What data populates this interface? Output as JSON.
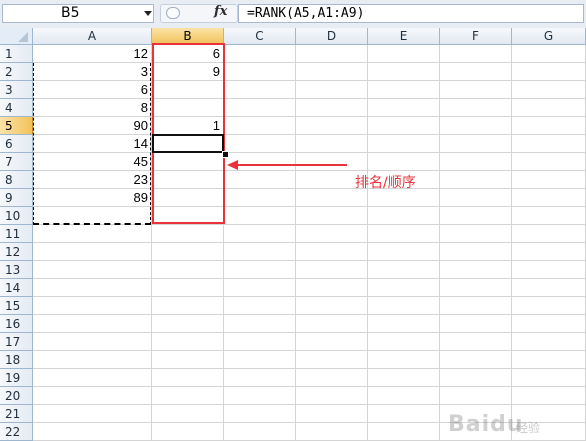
{
  "formula_bar": {
    "name_box": "B5",
    "fx_label": "fx",
    "formula": "=RANK(A5,A1:A9)"
  },
  "columns": [
    "A",
    "B",
    "C",
    "D",
    "E",
    "F",
    "G"
  ],
  "active_column": "B",
  "rows": [
    "1",
    "2",
    "3",
    "4",
    "5",
    "6",
    "7",
    "8",
    "9",
    "10",
    "11",
    "12",
    "13",
    "14",
    "15",
    "16",
    "17",
    "18",
    "19",
    "20",
    "21",
    "22"
  ],
  "active_row": "5",
  "column_a": [
    "12",
    "3",
    "6",
    "8",
    "90",
    "14",
    "45",
    "23",
    "89"
  ],
  "column_b": [
    "6",
    "9",
    "",
    "",
    "1",
    "",
    "",
    "",
    ""
  ],
  "annotation": {
    "label": "排名/顺序",
    "color": "#e8333a"
  },
  "watermark": {
    "brand": "Baidu",
    "suffix": "经验"
  }
}
